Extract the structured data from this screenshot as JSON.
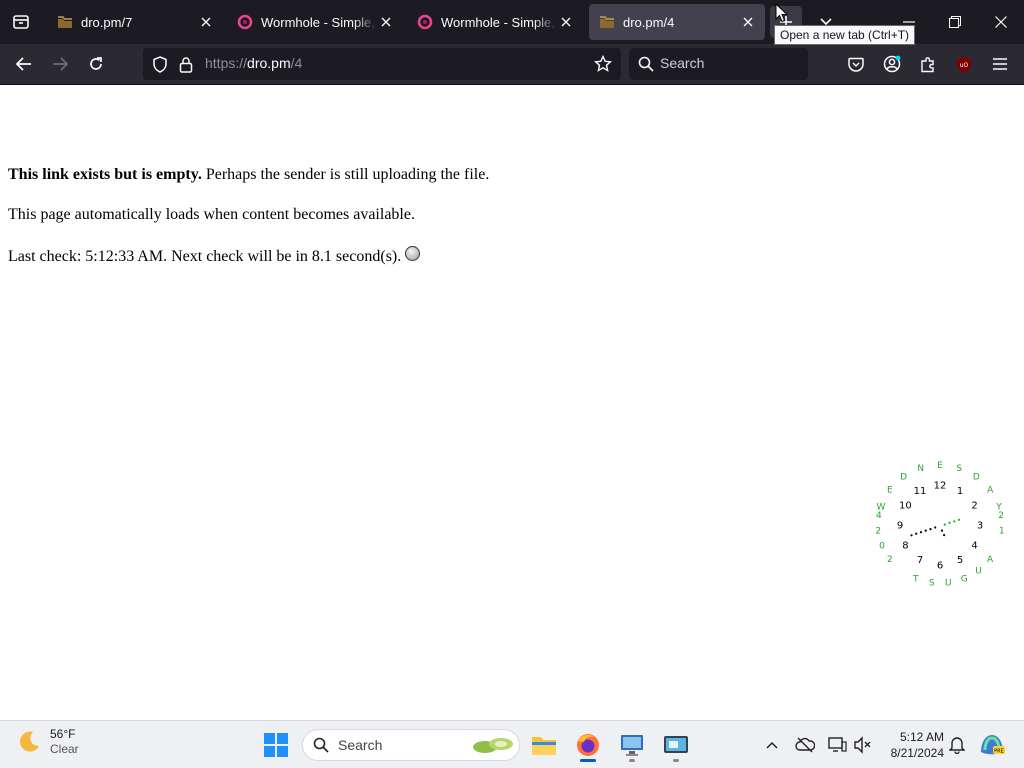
{
  "browser": {
    "tabs": [
      {
        "title": "dro.pm/7",
        "favicon": "dro-pm-favicon",
        "active": false
      },
      {
        "title": "Wormhole - Simple, private file sharing",
        "favicon": "wormhole-favicon",
        "active": false
      },
      {
        "title": "Wormhole - Simple, private file sharing",
        "favicon": "wormhole-favicon",
        "active": false
      },
      {
        "title": "dro.pm/4",
        "favicon": "dro-pm-favicon",
        "active": true
      }
    ],
    "tooltip": "Open a new tab (Ctrl+T)",
    "url": {
      "scheme": "https://",
      "host": "dro.pm",
      "path": "/4"
    },
    "search_placeholder": "Search",
    "colors": {
      "chrome_dark": "#1c1b22",
      "toolbar": "#2b2a33",
      "active_tab": "#42414d",
      "wormhole_pink": "#e84393"
    }
  },
  "page": {
    "line1_bold": "This link exists but is empty.",
    "line1_rest": " Perhaps the sender is still uploading the file.",
    "line2": "This page automatically loads when content becomes available.",
    "line3": "Last check: 5:12:33 AM. Next check will be in 8.1 second(s).",
    "spinner_icon": "loading-spinner-icon"
  },
  "clock_widget": {
    "numerals": [
      "12",
      "1",
      "2",
      "3",
      "4",
      "5",
      "6",
      "7",
      "8",
      "9",
      "10",
      "11"
    ],
    "day_text": "WEDNESDAY",
    "date_text": "21 AUGUST 2024",
    "time": "5:12",
    "colors": {
      "numerals": "#000000",
      "ring_text": "#2aa52a"
    }
  },
  "taskbar": {
    "weather": {
      "temp": "56°F",
      "condition": "Clear",
      "icon": "moon-icon"
    },
    "search_placeholder": "Search",
    "apps": [
      "start-button",
      "file-explorer",
      "firefox",
      "remote-desktop",
      "screen-app"
    ],
    "time": "5:12 AM",
    "date": "8/21/2024"
  }
}
